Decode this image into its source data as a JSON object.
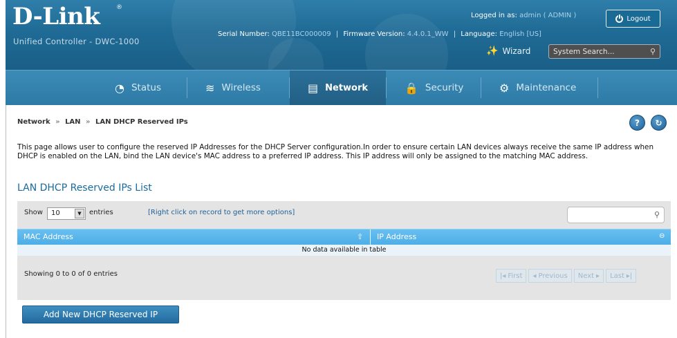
{
  "header": {
    "logo": "D-Link",
    "logo_mark": "®",
    "subtitle": "Unified Controller - DWC-1000",
    "logged_in_label": "Logged in as:",
    "logged_in_value": "admin ( ADMIN )",
    "serial_label": "Serial Number:",
    "serial_value": "QBE11BC000009",
    "firmware_label": "Firmware Version:",
    "firmware_value": "4.4.0.1_WW",
    "language_label": "Language:",
    "language_value": "English [US]",
    "separator": "|",
    "logout_label": "Logout",
    "wizard_label": "Wizard",
    "search_placeholder": "System Search..."
  },
  "nav": {
    "items": [
      {
        "label": "Status",
        "icon": "dashboard-icon"
      },
      {
        "label": "Wireless",
        "icon": "wifi-icon"
      },
      {
        "label": "Network",
        "icon": "computer-icon",
        "active": true
      },
      {
        "label": "Security",
        "icon": "lock-icon"
      },
      {
        "label": "Maintenance",
        "icon": "gears-icon"
      }
    ]
  },
  "breadcrumb": {
    "items": [
      "Network",
      "LAN",
      "LAN DHCP Reserved IPs"
    ],
    "separator": "»"
  },
  "help_buttons": {
    "help": "?",
    "refresh": "↻"
  },
  "description": "This page allows user to configure the reserved IP Addresses for the DHCP Server configuration.In order to ensure certain LAN devices always receive the same IP address when DHCP is enabled on the LAN, bind the LAN device's MAC address to a preferred IP address. This IP address will only be assigned to the matching MAC address.",
  "section_title": "LAN DHCP Reserved IPs List",
  "table": {
    "show_label": "Show",
    "page_length": "10",
    "entries_label": "entries",
    "hint": "[Right click on record to get more options]",
    "columns": [
      "MAC Address",
      "IP Address"
    ],
    "empty_message": "No data available in table",
    "info": "Showing 0 to 0 of 0 entries",
    "pagination": {
      "first": "First",
      "previous": "Previous",
      "next": "Next",
      "last": "Last"
    }
  },
  "add_button": "Add New DHCP Reserved IP",
  "colors": {
    "header_bg": "#1f6b96",
    "nav_bg": "#2d7aa6",
    "table_header": "#4daee6",
    "accent_text": "#1b6a9c"
  }
}
